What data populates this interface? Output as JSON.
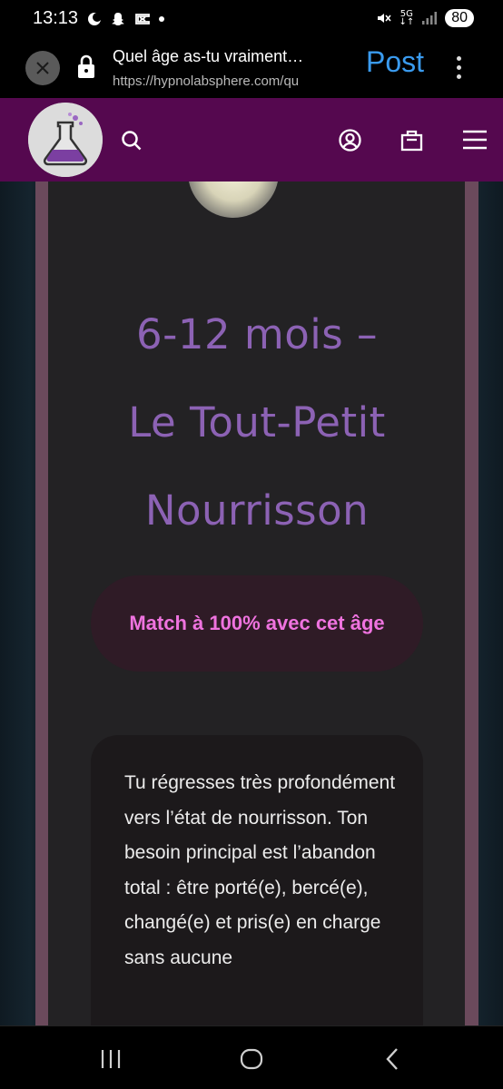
{
  "status_bar": {
    "time": "13:13",
    "network": "5G",
    "battery": "80"
  },
  "browser": {
    "page_title": "Quel âge as-tu vraiment…",
    "url": "https://hypnolabsphere.com/qu",
    "post_label": "Post"
  },
  "site_nav": {
    "icons": [
      "search-icon",
      "account-icon",
      "bag-icon",
      "menu-icon"
    ]
  },
  "result": {
    "headline_line1": "6-12 mois –",
    "headline_line2": "Le Tout-Petit",
    "headline_line3": "Nourrisson",
    "match": "Match à 100% avec cet âge",
    "description": "Tu régresses très profondément vers l’état de nourrisson. Ton besoin principal est l’abandon total : être porté(e), bercé(e), changé(e) et pris(e) en charge sans aucune"
  },
  "colors": {
    "nav_bg": "#55084f",
    "headline": "#8c62b4",
    "match_text": "#ef73df",
    "post_button": "#3a9bef"
  }
}
